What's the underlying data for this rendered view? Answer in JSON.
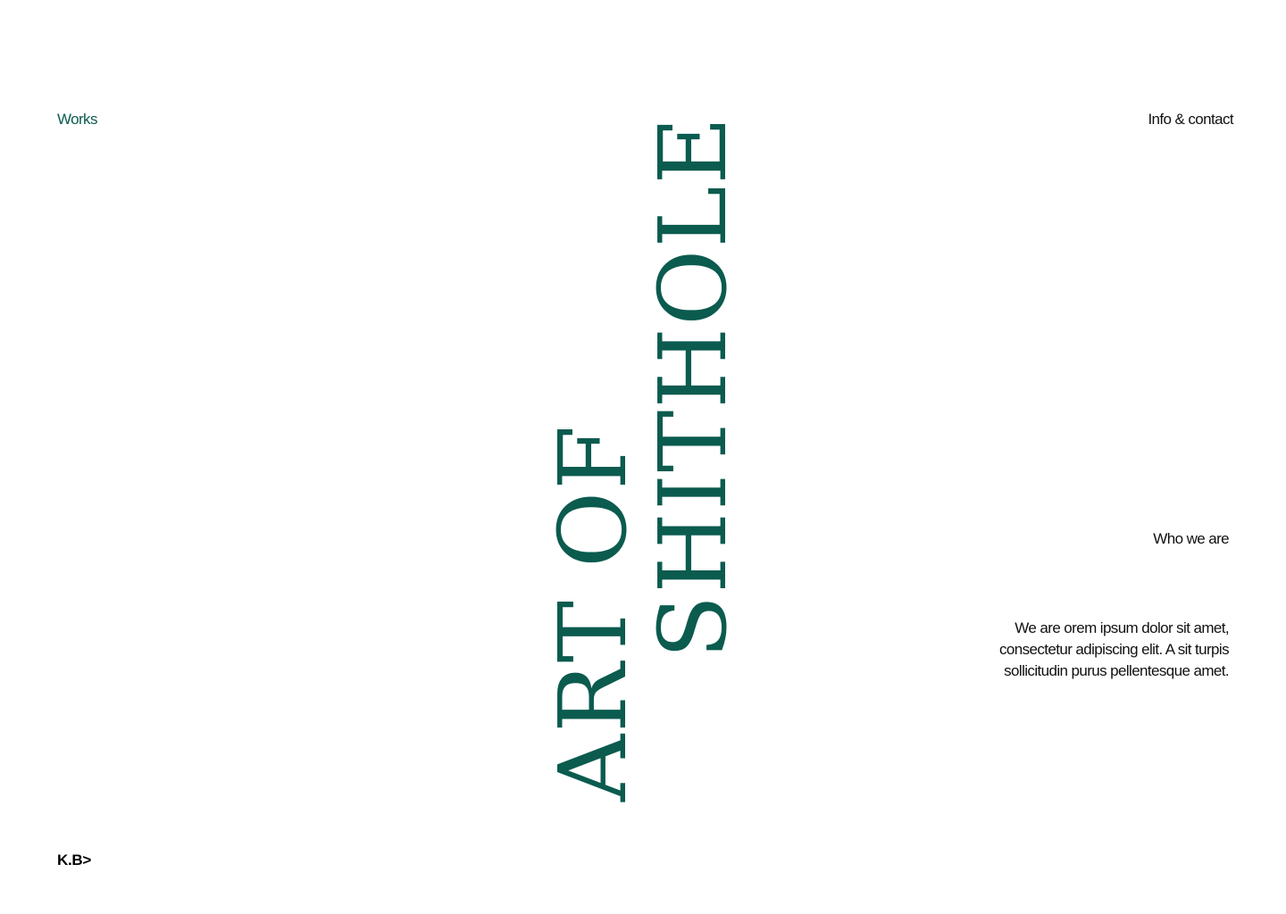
{
  "nav": {
    "works_label": "Works",
    "info_label": "Info & contact"
  },
  "hero": {
    "title_line_1": "ART OF",
    "title_line_2": "SHITHOLE"
  },
  "about": {
    "heading": "Who we are",
    "body": "We are orem ipsum dolor sit amet, consectetur adipiscing elit. A sit turpis sollicitudin purus pellentesque amet."
  },
  "footer": {
    "logo_text": "K.B>"
  },
  "colors": {
    "accent": "#0b5b4f",
    "text": "#111111",
    "background": "#ffffff"
  }
}
